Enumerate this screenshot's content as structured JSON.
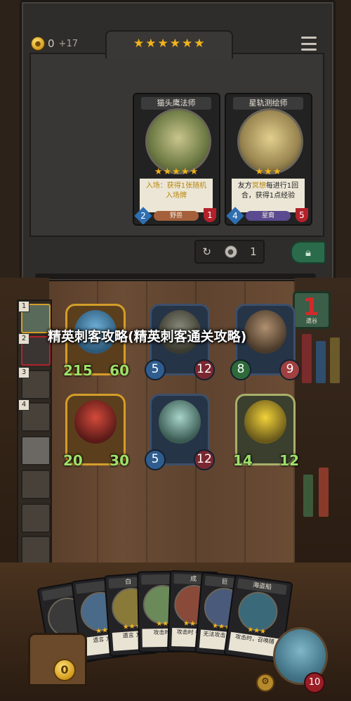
{
  "overlay": {
    "title": "精英刺客攻略(精英刺客通关攻略)"
  },
  "shop": {
    "coins": "0",
    "income": "+17",
    "tavern_stars": "★★★★★★",
    "refresh_cost": "1",
    "cards": [
      {
        "name": "猫头鹰法师",
        "stars": "★★★★★",
        "desc_prefix": "入场：获得1张随机",
        "desc_suffix": "入场牌",
        "attack": "2",
        "health": "1",
        "tag": "野兽",
        "tag_color": "#a4603b"
      },
      {
        "name": "星轨测绘师",
        "stars": "★★★",
        "desc_prefix": "友方",
        "desc_highlight": "冥想",
        "desc_mid": "每进行1回",
        "desc_suffix": "合，获得1点经验",
        "attack": "4",
        "health": "5",
        "tag": "星裔",
        "tag_color": "#5a4a8f"
      }
    ]
  },
  "tavern_level": {
    "value": "1",
    "label": "遗谷"
  },
  "sidebar": {
    "slots": [
      "1",
      "2",
      "3",
      "4"
    ]
  },
  "board": {
    "units": [
      {
        "attack": "215",
        "health": "60"
      },
      {
        "attack": "5",
        "health": "12"
      },
      {
        "attack": "8",
        "health": "9"
      },
      {
        "attack": "20",
        "health": "30"
      },
      {
        "attack": "5",
        "health": "12"
      },
      {
        "attack": "14",
        "health": "12"
      }
    ]
  },
  "hand": {
    "cards": [
      {
        "name": "海盗船",
        "stars": "★★★",
        "desc": "攻击时，召唤随"
      },
      {
        "name": "巨",
        "stars": "★★★",
        "desc": "无法攻击，召"
      },
      {
        "name": "成",
        "stars": "★★★",
        "desc": "攻击时 得本"
      },
      {
        "name": "",
        "stars": "★★",
        "desc": "攻击时"
      },
      {
        "name": "白",
        "stars": "★★★",
        "desc": "遗言 方"
      },
      {
        "name": "",
        "stars": "★★",
        "desc": "遗言 方"
      },
      {
        "name": "",
        "stars": "★★",
        "desc": "先手"
      }
    ]
  },
  "player": {
    "gold_in_chest": "0",
    "hero_health": "10"
  }
}
